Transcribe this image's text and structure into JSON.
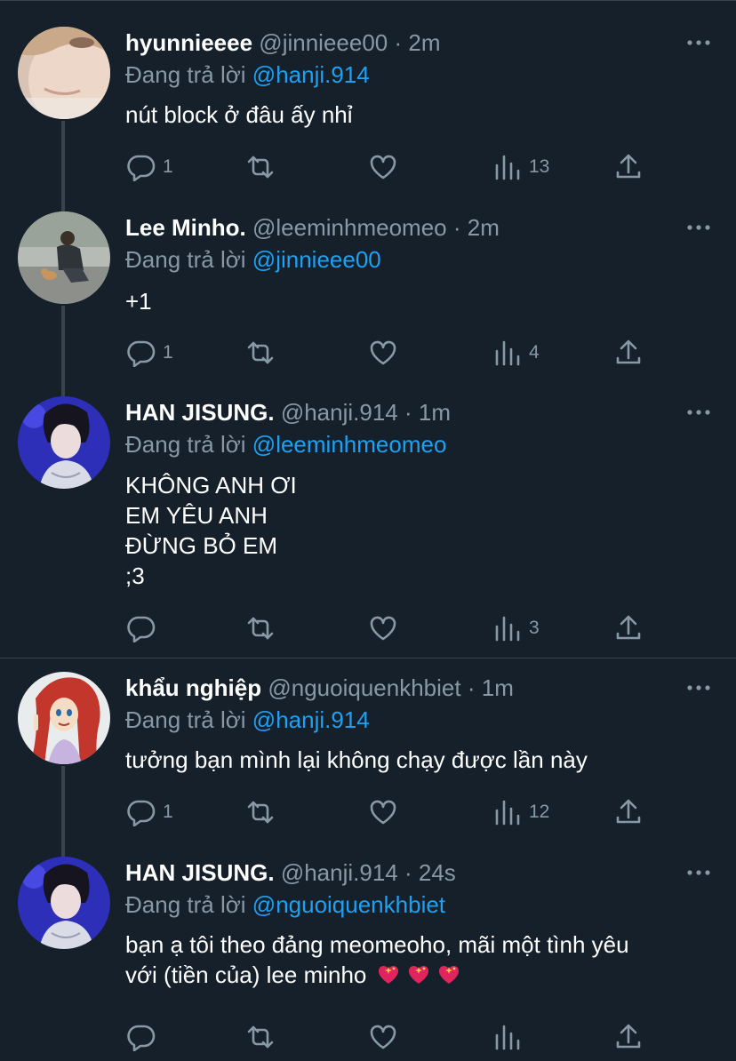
{
  "colors": {
    "background": "#15202b",
    "muted": "#8899a6",
    "link": "#1da1f2",
    "divider": "#38444d"
  },
  "tweets": [
    {
      "name": "hyunnieeee",
      "handle": "@jinnieee00",
      "time": "2m",
      "reply_prefix": "Đang trả lời",
      "reply_to": "@hanji.914",
      "text_lines": [
        "nút block ở đâu ấy nhỉ"
      ],
      "reply_count": "1",
      "views": "13",
      "avatar_icon": "girl-avatar"
    },
    {
      "name": "Lee Minho.",
      "handle": "@leeminhmeomeo",
      "time": "2m",
      "reply_prefix": "Đang trả lời",
      "reply_to": "@jinnieee00",
      "text_lines": [
        "+1"
      ],
      "reply_count": "1",
      "views": "4",
      "avatar_icon": "man-with-cat-avatar"
    },
    {
      "name": "HAN JISUNG.",
      "handle": "@hanji.914",
      "time": "1m",
      "reply_prefix": "Đang trả lời",
      "reply_to": "@leeminhmeomeo",
      "text_lines": [
        "KHÔNG ANH ƠI",
        "EM YÊU ANH",
        "ĐỪNG BỎ EM",
        ";3"
      ],
      "reply_count": "",
      "views": "3",
      "avatar_icon": "boy-avatar"
    },
    {
      "name": "khẩu nghiệp",
      "handle": "@nguoiquenkhbiet",
      "time": "1m",
      "reply_prefix": "Đang trả lời",
      "reply_to": "@hanji.914",
      "text_lines": [
        "tưởng bạn mình lại không chạy được lần này"
      ],
      "reply_count": "1",
      "views": "12",
      "avatar_icon": "princess-avatar"
    },
    {
      "name": "HAN JISUNG.",
      "handle": "@hanji.914",
      "time": "24s",
      "reply_prefix": "Đang trả lời",
      "reply_to": "@nguoiquenkhbiet",
      "text_lines": [
        "bạn ạ tôi theo đảng meomeoho, mãi một tình yêu",
        "với (tiền của) lee minho"
      ],
      "reply_count": "",
      "views": "",
      "avatar_icon": "boy-avatar"
    }
  ]
}
